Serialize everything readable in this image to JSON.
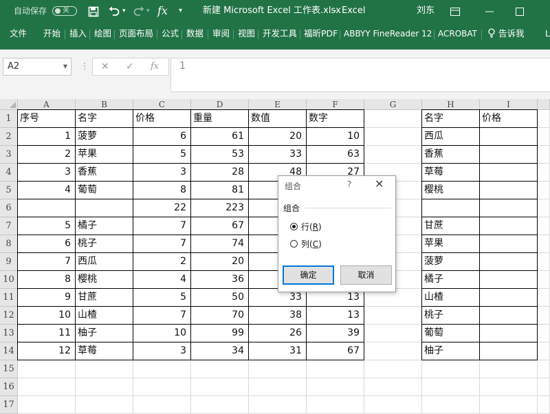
{
  "titlebar": {
    "autosave_label": "自动保存",
    "autosave_state": "关",
    "redo_dropdown": "▾",
    "customize_label": "▾",
    "document_title": "新建 Microsoft Excel 工作表.xlsx",
    "app_separator": "-",
    "app_name": "Excel",
    "user_name": "刘东"
  },
  "ribbon": {
    "tabs": [
      "文件",
      "开始",
      "插入",
      "绘图",
      "页面布局",
      "公式",
      "数据",
      "审阅",
      "视图",
      "开发工具",
      "福昕PDF",
      "ABBYY FineReader 12",
      "ACROBAT"
    ],
    "tell_me": "告诉我",
    "overflow_tab": "L"
  },
  "formula_bar": {
    "name_box": "A2",
    "fx": "fx",
    "value": "1"
  },
  "sheet": {
    "columns": [
      "A",
      "B",
      "C",
      "D",
      "E",
      "F",
      "G",
      "H",
      "I"
    ],
    "rows": [
      "1",
      "2",
      "3",
      "4",
      "5",
      "6",
      "7",
      "8",
      "9",
      "10",
      "11",
      "12",
      "13",
      "14",
      "15",
      "16",
      "17"
    ],
    "headers": {
      "A": "序号",
      "B": "名字",
      "C": "价格",
      "D": "重量",
      "E": "数值",
      "F": "数字",
      "H": "名字",
      "I": "价格"
    },
    "table": [
      {
        "A": "1",
        "B": "菠萝",
        "C": "6",
        "D": "61",
        "E": "20",
        "F": "10"
      },
      {
        "A": "2",
        "B": "苹果",
        "C": "5",
        "D": "53",
        "E": "33",
        "F": "63"
      },
      {
        "A": "3",
        "B": "香蕉",
        "C": "3",
        "D": "28",
        "E": "48",
        "F": "27"
      },
      {
        "A": "4",
        "B": "葡萄",
        "C": "8",
        "D": "81",
        "E": "",
        "F": ""
      },
      {
        "A": "",
        "B": "",
        "C": "22",
        "D": "223",
        "E": "",
        "F": ""
      },
      {
        "A": "5",
        "B": "橘子",
        "C": "7",
        "D": "67",
        "E": "",
        "F": ""
      },
      {
        "A": "6",
        "B": "桃子",
        "C": "7",
        "D": "74",
        "E": "",
        "F": ""
      },
      {
        "A": "7",
        "B": "西瓜",
        "C": "2",
        "D": "20",
        "E": "",
        "F": ""
      },
      {
        "A": "8",
        "B": "樱桃",
        "C": "4",
        "D": "36",
        "E": "",
        "F": ""
      },
      {
        "A": "9",
        "B": "甘蔗",
        "C": "5",
        "D": "50",
        "E": "33",
        "F": "13"
      },
      {
        "A": "10",
        "B": "山楂",
        "C": "7",
        "D": "70",
        "E": "38",
        "F": "13"
      },
      {
        "A": "11",
        "B": "柚子",
        "C": "10",
        "D": "99",
        "E": "26",
        "F": "39"
      },
      {
        "A": "12",
        "B": "草莓",
        "C": "3",
        "D": "34",
        "E": "31",
        "F": "67"
      }
    ],
    "side_list": [
      "西瓜",
      "香蕉",
      "草莓",
      "樱桃",
      "",
      "甘蔗",
      "苹果",
      "菠萝",
      "橘子",
      "山楂",
      "桃子",
      "葡萄",
      "柚子"
    ]
  },
  "dialog": {
    "title": "组合",
    "help": "?",
    "close": "✕",
    "group_label": "组合",
    "options": [
      {
        "label": "行",
        "key": "R",
        "selected": true
      },
      {
        "label": "列",
        "key": "C",
        "selected": false
      }
    ],
    "ok": "确定",
    "cancel": "取消"
  },
  "colors": {
    "accent": "#217346",
    "primary_button_border": "#0078d7"
  }
}
